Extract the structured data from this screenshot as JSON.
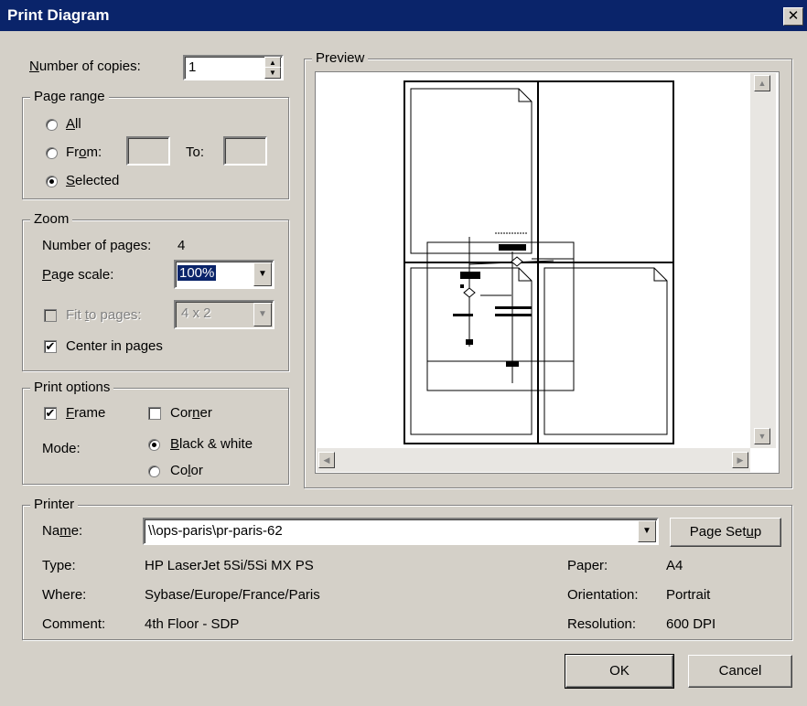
{
  "window": {
    "title": "Print Diagram",
    "close_label": "✕"
  },
  "copies": {
    "label_u": "N",
    "label_rest": "umber of copies:",
    "value": "1"
  },
  "page_range": {
    "legend": "Page range",
    "all_u": "A",
    "all_rest": "ll",
    "from_a": "Fr",
    "from_u": "o",
    "from_b": "m:",
    "to_label": "To:",
    "selected_u": "S",
    "selected_rest": "elected",
    "selected_option": "selected"
  },
  "zoom": {
    "legend": "Zoom",
    "pages_label": "Number of pages:",
    "pages_value": "4",
    "scale_u": "P",
    "scale_rest": "age scale:",
    "scale_value": "100%",
    "fit_a": "Fit ",
    "fit_u": "t",
    "fit_b": "o pages:",
    "fit_value": "4 x 2",
    "fit_checked": false,
    "center_label": "Center in pages",
    "center_checked": true
  },
  "print_options": {
    "legend": "Print options",
    "frame_u": "F",
    "frame_rest": "rame",
    "frame_checked": true,
    "corner_a": "Cor",
    "corner_u": "n",
    "corner_b": "er",
    "corner_checked": false,
    "mode_label": "Mode:",
    "bw_u": "B",
    "bw_rest": "lack & white",
    "color_a": "Co",
    "color_u": "l",
    "color_b": "or",
    "mode_selected": "black_white"
  },
  "preview": {
    "legend": "Preview",
    "scroll_up": "▲",
    "scroll_down": "▼",
    "scroll_left": "◀",
    "scroll_right": "▶"
  },
  "printer": {
    "legend": "Printer",
    "name_a": "Na",
    "name_u": "m",
    "name_b": "e:",
    "name_value": "\\\\ops-paris\\pr-paris-62",
    "setup_a": "Page Set",
    "setup_u": "u",
    "setup_b": "p",
    "type_label": "Type:",
    "type_value": "HP LaserJet 5Si/5Si MX PS",
    "where_label": "Where:",
    "where_value": "Sybase/Europe/France/Paris",
    "comment_label": "Comment:",
    "comment_value": "4th Floor - SDP",
    "paper_label": "Paper:",
    "paper_value": "A4",
    "orientation_label": "Orientation:",
    "orientation_value": "Portrait",
    "resolution_label": "Resolution:",
    "resolution_value": "600 DPI"
  },
  "buttons": {
    "ok": "OK",
    "cancel": "Cancel"
  },
  "icons": {
    "spin_up": "▲",
    "spin_down": "▼",
    "dropdown": "▼",
    "check": "✔"
  }
}
